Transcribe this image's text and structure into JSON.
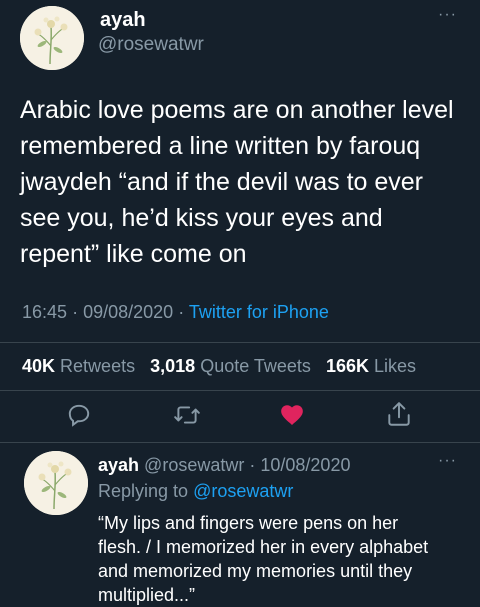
{
  "colors": {
    "background": "#15202b",
    "text": "#ffffff",
    "muted": "#8899a6",
    "link": "#1da1f2",
    "like": "#e0245e",
    "divider": "#38444d"
  },
  "main_tweet": {
    "author": {
      "name": "ayah",
      "handle": "@rosewatwr"
    },
    "text_lines": [
      "Arabic love poems are on another level",
      "remembered a line written by farouq",
      "jwaydeh “and if the devil was to ever",
      "see you, he’d kiss your eyes and",
      "repent” like come on"
    ],
    "time": "16:45",
    "date": "09/08/2020",
    "source": "Twitter for iPhone",
    "sep": "·",
    "stats": {
      "retweets_count": "40K",
      "retweets_label": "Retweets",
      "quotes_count": "3,018",
      "quotes_label": "Quote Tweets",
      "likes_count": "166K",
      "likes_label": "Likes"
    },
    "actions": [
      "reply-icon",
      "retweet-icon",
      "like-icon",
      "share-icon"
    ]
  },
  "reply_tweet": {
    "author": {
      "name": "ayah",
      "handle": "@rosewatwr"
    },
    "sep": "·",
    "date": "10/08/2020",
    "replying_prefix": "Replying to",
    "replying_handle": "@rosewatwr",
    "text_lines": [
      "“My lips and fingers were pens on her",
      "flesh. /  I memorized her in every alphabet",
      "and memorized my memories until they",
      "multiplied...”"
    ]
  }
}
